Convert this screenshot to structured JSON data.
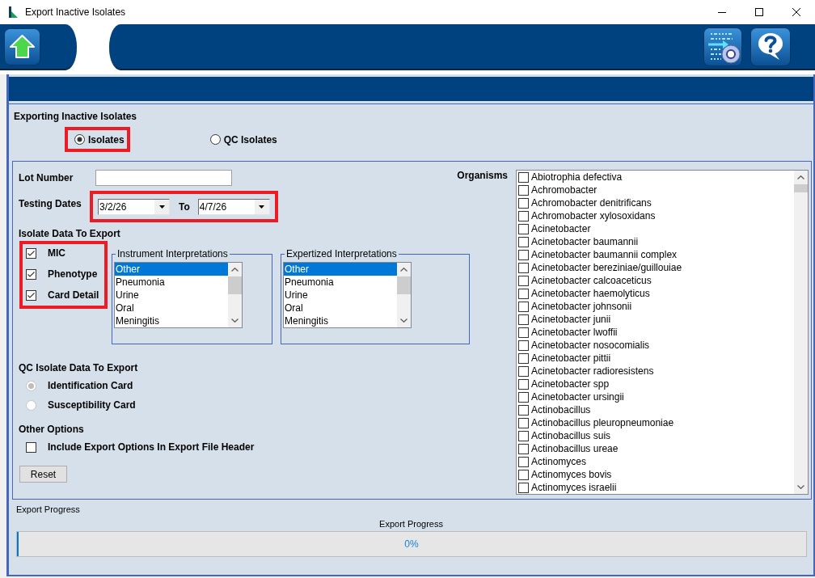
{
  "window": {
    "title": "Export Inactive Isolates"
  },
  "export_type": {
    "heading": "Exporting Inactive Isolates",
    "options": [
      {
        "label": "Isolates",
        "selected": true,
        "highlighted": true
      },
      {
        "label": "QC Isolates",
        "selected": false,
        "highlighted": false
      }
    ]
  },
  "lot_number": {
    "label": "Lot Number"
  },
  "testing_dates": {
    "label": "Testing Dates",
    "from": "3/2/26",
    "separator": "To",
    "to": "4/7/26",
    "highlighted": true
  },
  "isolate_data": {
    "heading": "Isolate Data To Export",
    "highlighted": true,
    "options": [
      {
        "label": "MIC",
        "checked": true
      },
      {
        "label": "Phenotype",
        "checked": true
      },
      {
        "label": "Card Detail",
        "checked": true
      }
    ]
  },
  "interpretation_lists": [
    {
      "title": "Instrument Interpretations",
      "items": [
        {
          "label": "Other",
          "selected": true
        },
        {
          "label": "Pneumonia",
          "selected": false
        },
        {
          "label": "Urine",
          "selected": false
        },
        {
          "label": "Oral",
          "selected": false
        },
        {
          "label": "Meningitis",
          "selected": false
        }
      ]
    },
    {
      "title": "Expertized Interpretations",
      "items": [
        {
          "label": "Other",
          "selected": true
        },
        {
          "label": "Pneumonia",
          "selected": false
        },
        {
          "label": "Urine",
          "selected": false
        },
        {
          "label": "Oral",
          "selected": false
        },
        {
          "label": "Meningitis",
          "selected": false
        }
      ]
    }
  ],
  "qc_isolate_data": {
    "heading": "QC Isolate Data To Export",
    "options": [
      {
        "label": "Identification Card",
        "selected": true,
        "disabled": true
      },
      {
        "label": "Susceptibility Card",
        "selected": false,
        "disabled": true
      }
    ]
  },
  "other_options": {
    "heading": "Other Options",
    "options": [
      {
        "label": "Include Export Options In Export File Header",
        "checked": false
      }
    ]
  },
  "reset_button": {
    "label": "Reset"
  },
  "organisms": {
    "label": "Organisms",
    "items": [
      {
        "name": "Abiotrophia defectiva",
        "checked": false
      },
      {
        "name": "Achromobacter",
        "checked": false
      },
      {
        "name": "Achromobacter denitrificans",
        "checked": false
      },
      {
        "name": "Achromobacter xylosoxidans",
        "checked": false
      },
      {
        "name": "Acinetobacter",
        "checked": false
      },
      {
        "name": "Acinetobacter baumannii",
        "checked": false
      },
      {
        "name": "Acinetobacter baumannii complex",
        "checked": false
      },
      {
        "name": "Acinetobacter bereziniae/guillouiae",
        "checked": false
      },
      {
        "name": "Acinetobacter calcoaceticus",
        "checked": false
      },
      {
        "name": "Acinetobacter haemolyticus",
        "checked": false
      },
      {
        "name": "Acinetobacter johnsonii",
        "checked": false
      },
      {
        "name": "Acinetobacter junii",
        "checked": false
      },
      {
        "name": "Acinetobacter lwoffii",
        "checked": false
      },
      {
        "name": "Acinetobacter nosocomialis",
        "checked": false
      },
      {
        "name": "Acinetobacter pittii",
        "checked": false
      },
      {
        "name": "Acinetobacter radioresistens",
        "checked": false
      },
      {
        "name": "Acinetobacter spp",
        "checked": false
      },
      {
        "name": "Acinetobacter ursingii",
        "checked": false
      },
      {
        "name": "Actinobacillus",
        "checked": false
      },
      {
        "name": "Actinobacillus pleuropneumoniae",
        "checked": false
      },
      {
        "name": "Actinobacillus suis",
        "checked": false
      },
      {
        "name": "Actinobacillus ureae",
        "checked": false
      },
      {
        "name": "Actinomyces",
        "checked": false
      },
      {
        "name": "Actinomyces bovis",
        "checked": false
      },
      {
        "name": "Actinomyces israelii",
        "checked": false
      }
    ]
  },
  "export_progress": {
    "label": "Export Progress",
    "caption": "Export Progress",
    "level": 0,
    "reading": "0%"
  }
}
